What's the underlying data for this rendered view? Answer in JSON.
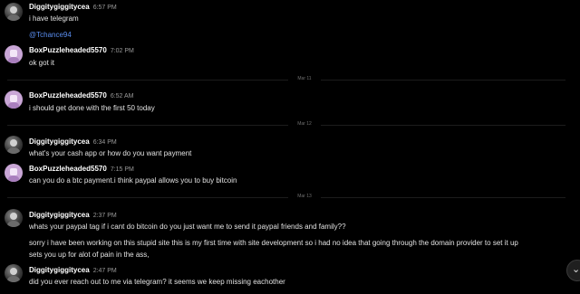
{
  "messages": [
    {
      "user": "Diggitygiggitycea",
      "time": "6:57 PM",
      "lines": [
        "i have telegram",
        "@Tchance94"
      ]
    },
    {
      "user": "BoxPuzzleheaded5570",
      "time": "7:02 PM",
      "lines": [
        "ok got it"
      ]
    },
    {
      "user": "BoxPuzzleheaded5570",
      "time": "6:52 AM",
      "lines": [
        "i should get done with the first 50 today"
      ]
    },
    {
      "user": "Diggitygiggitycea",
      "time": "6:34 PM",
      "lines": [
        "what's your cash app or how do you want payment"
      ]
    },
    {
      "user": "BoxPuzzleheaded5570",
      "time": "7:15 PM",
      "lines": [
        "can you do a btc payment.i think paypal allows you to buy bitcoin"
      ]
    },
    {
      "user": "Diggitygiggitycea",
      "time": "2:37 PM",
      "lines": [
        "whats your paypal tag if i cant do bitcoin do you just want me to send it paypal friends and family??",
        "sorry i have been working on this stupid site this is my first time with site development so i had no idea that going through the domain provider to set it up",
        "sets you up for alot of pain in the ass,"
      ]
    },
    {
      "user": "Diggitygiggitycea",
      "time": "2:47 PM",
      "lines": [
        "did you ever reach out to me via telegram? it seems we keep missing eachother"
      ]
    }
  ],
  "dates": [
    "Mar 11",
    "Mar 12",
    "Mar 13"
  ],
  "scroll_icon": "chevron-down-icon"
}
